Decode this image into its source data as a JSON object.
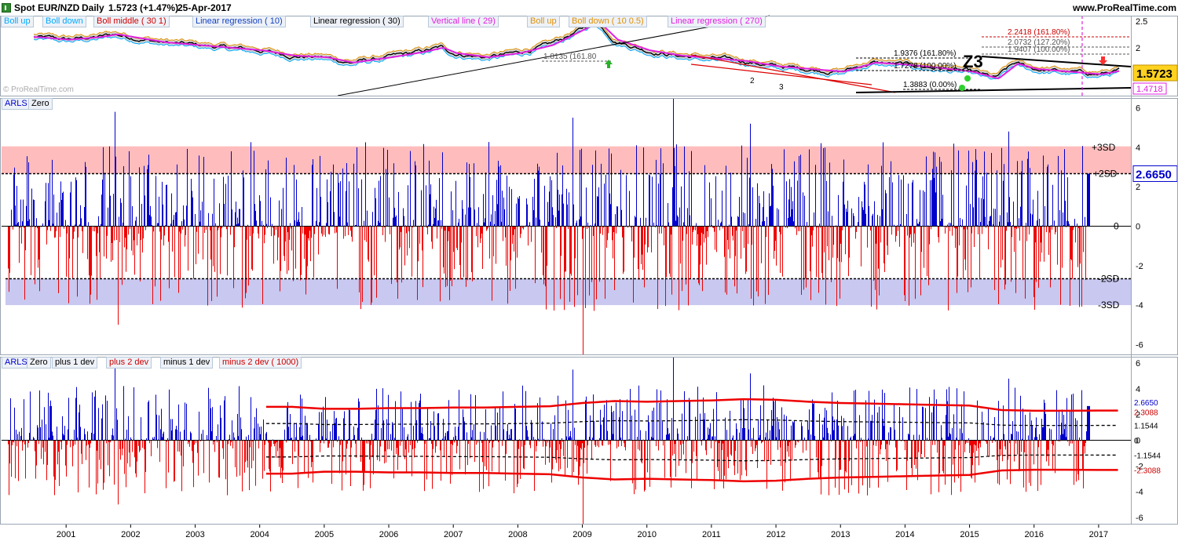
{
  "header": {
    "symbol": "Spot EUR/NZD",
    "period": "Daily",
    "price_change": "1.5723 (+1.47%)",
    "date": "25-Apr-2017",
    "website": "www.ProRealTime.com"
  },
  "price_panel": {
    "watermark": "© ProRealTime.com",
    "indicator_tags": [
      {
        "label": "Boll up",
        "color": "#00aaff"
      },
      {
        "label": "Boll down",
        "color": "#00aaff"
      },
      {
        "label": "Boll middle ( 30 1)",
        "color": "#d00000"
      },
      {
        "label": "Linear regression ( 10)",
        "color": "#1040c0"
      },
      {
        "label": "Linear regression ( 30)",
        "color": "#000000"
      },
      {
        "label": "Vertical line ( 29)",
        "color": "#e020e0"
      },
      {
        "label": "Boll up",
        "color": "#e09000"
      },
      {
        "label": "Boll down ( 10 0.5)",
        "color": "#e09000"
      },
      {
        "label": "Linear regression ( 270)",
        "color": "#e020e0"
      }
    ],
    "fib_labels": [
      {
        "text": "2.2418 (161.80%)",
        "color": "#cc0000"
      },
      {
        "text": "2.0732 (127.20%)",
        "color": "#555555"
      },
      {
        "text": "1.9407 (100.00%)",
        "color": "#555555"
      },
      {
        "text": "1.9376 (161.80%)",
        "color": "#000000"
      },
      {
        "text": "1.7278 (100.00%)",
        "color": "#000000"
      },
      {
        "text": "1.3883 (0.00%)",
        "color": "#000000"
      },
      {
        "text": "1.8135 (161.80",
        "color": "#555555"
      }
    ],
    "wave_labels": [
      "Z3",
      "2",
      "3"
    ],
    "axis_ticks": [
      "2.5",
      "2",
      "1.5"
    ],
    "last_price": "1.5723",
    "secondary_price": "1.4718",
    "ylim": [
      1.1,
      2.6
    ]
  },
  "arls_panel": {
    "legend": [
      "ARLS",
      "Zero"
    ],
    "band_labels": [
      "+3SD",
      "+2SD",
      "0",
      "-2SD",
      "-3SD"
    ],
    "axis_ticks": [
      "6",
      "4",
      "2",
      "0",
      "-2",
      "-4",
      "-6"
    ],
    "last_value": "2.6650"
  },
  "dev_panel": {
    "legend": [
      {
        "label": "ARLS",
        "color": "#0000cc"
      },
      {
        "label": "Zero",
        "color": "#000000"
      },
      {
        "label": "plus 1 dev",
        "color": "#000000"
      },
      {
        "label": "plus 2 dev",
        "color": "#cc0000"
      },
      {
        "label": "minus 1 dev",
        "color": "#000000"
      },
      {
        "label": "minus 2 dev ( 1000)",
        "color": "#cc0000"
      }
    ],
    "axis_ticks": [
      "6",
      "4",
      "2",
      "0",
      "-2",
      "-4",
      "-6"
    ],
    "value_labels": [
      {
        "text": "2.6650",
        "color": "#0000cc"
      },
      {
        "text": "2.3088",
        "color": "#cc0000"
      },
      {
        "text": "1.1544",
        "color": "#000000"
      },
      {
        "text": "0",
        "color": "#000000"
      },
      {
        "text": "-1.1544",
        "color": "#000000"
      },
      {
        "text": "-2.3088",
        "color": "#cc0000"
      }
    ]
  },
  "x_axis": {
    "years": [
      "2001",
      "2002",
      "2003",
      "2004",
      "2005",
      "2006",
      "2007",
      "2008",
      "2009",
      "2010",
      "2011",
      "2012",
      "2013",
      "2014",
      "2015",
      "2016",
      "2017"
    ]
  },
  "chart_data": [
    {
      "type": "line",
      "title": "Spot EUR/NZD Daily",
      "x": [
        2000.5,
        2001.0,
        2001.5,
        2001.75,
        2002.0,
        2002.5,
        2003.0,
        2003.5,
        2004.0,
        2004.5,
        2005.0,
        2005.4,
        2005.75,
        2006.0,
        2006.5,
        2006.8,
        2007.0,
        2007.5,
        2008.0,
        2008.5,
        2009.0,
        2009.2,
        2009.5,
        2010.0,
        2010.5,
        2011.0,
        2011.5,
        2012.0,
        2012.5,
        2013.0,
        2013.5,
        2014.0,
        2014.5,
        2015.0,
        2015.4,
        2015.7,
        2016.0,
        2016.5,
        2017.0,
        2017.32
      ],
      "y": [
        2.2,
        2.15,
        2.2,
        2.25,
        2.2,
        2.1,
        2.05,
        2.0,
        1.95,
        1.85,
        1.82,
        1.72,
        1.78,
        1.82,
        1.92,
        2.0,
        1.9,
        1.82,
        1.9,
        2.05,
        2.35,
        2.5,
        2.15,
        1.95,
        1.85,
        1.8,
        1.75,
        1.65,
        1.6,
        1.55,
        1.72,
        1.68,
        1.62,
        1.55,
        1.42,
        1.7,
        1.6,
        1.55,
        1.5,
        1.5723
      ],
      "ylim": [
        1.1,
        2.6
      ]
    },
    {
      "type": "bar",
      "title": "ARLS",
      "y_range": [
        -6.5,
        6.5
      ],
      "bands": {
        "plus_3sd": 4.0,
        "plus_2sd": 2.665,
        "minus_2sd": -2.665,
        "minus_3sd": -4.0
      },
      "spikes": [
        {
          "x": 2001.75,
          "y": 5.8
        },
        {
          "x": 2001.8,
          "y": -5.0
        },
        {
          "x": 2008.85,
          "y": 5.5
        },
        {
          "x": 2009.0,
          "y": -6.5
        },
        {
          "x": 2010.4,
          "y": 6.5
        },
        {
          "x": 2011.6,
          "y": 5.2
        },
        {
          "x": 2015.6,
          "y": 4.8
        },
        {
          "x": 2017.3,
          "y": 2.665
        }
      ],
      "last_value": 2.665
    },
    {
      "type": "bar",
      "title": "ARLS with deviation bands ( 1000)",
      "y_range": [
        -6.5,
        6.5
      ],
      "series": [
        {
          "name": "plus 2 dev",
          "value_last": 2.3088
        },
        {
          "name": "plus 1 dev",
          "value_last": 1.1544
        },
        {
          "name": "minus 1 dev",
          "value_last": -1.1544
        },
        {
          "name": "minus 2 dev ( 1000)",
          "value_last": -2.3088
        }
      ],
      "last_value": 2.665
    }
  ]
}
